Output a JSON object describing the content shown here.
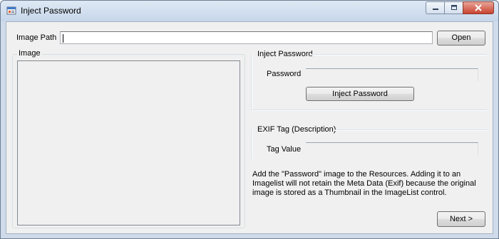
{
  "window": {
    "title": "Inject Password",
    "icon": "app-window-icon"
  },
  "image_path": {
    "label": "Image Path",
    "value": "",
    "open_button": "Open"
  },
  "image_group": {
    "title": "Image"
  },
  "inject_group": {
    "title": "Inject Password",
    "password_label": "Password",
    "password_value": "",
    "button": "Inject Password"
  },
  "exif_group": {
    "title": "EXIF Tag (Description)",
    "tag_value_label": "Tag Value",
    "tag_value": ""
  },
  "note": "Add the \"Password\" image to the Resources. Adding it to an Imagelist will not retain the Meta Data (Exif) because the original image is stored as a Thumbnail in the ImageList control.",
  "next_button": "Next >",
  "colors": {
    "title_bar": "#c6d6ea",
    "close_button": "#c9432f",
    "dialog_face": "#f0f0f0"
  }
}
